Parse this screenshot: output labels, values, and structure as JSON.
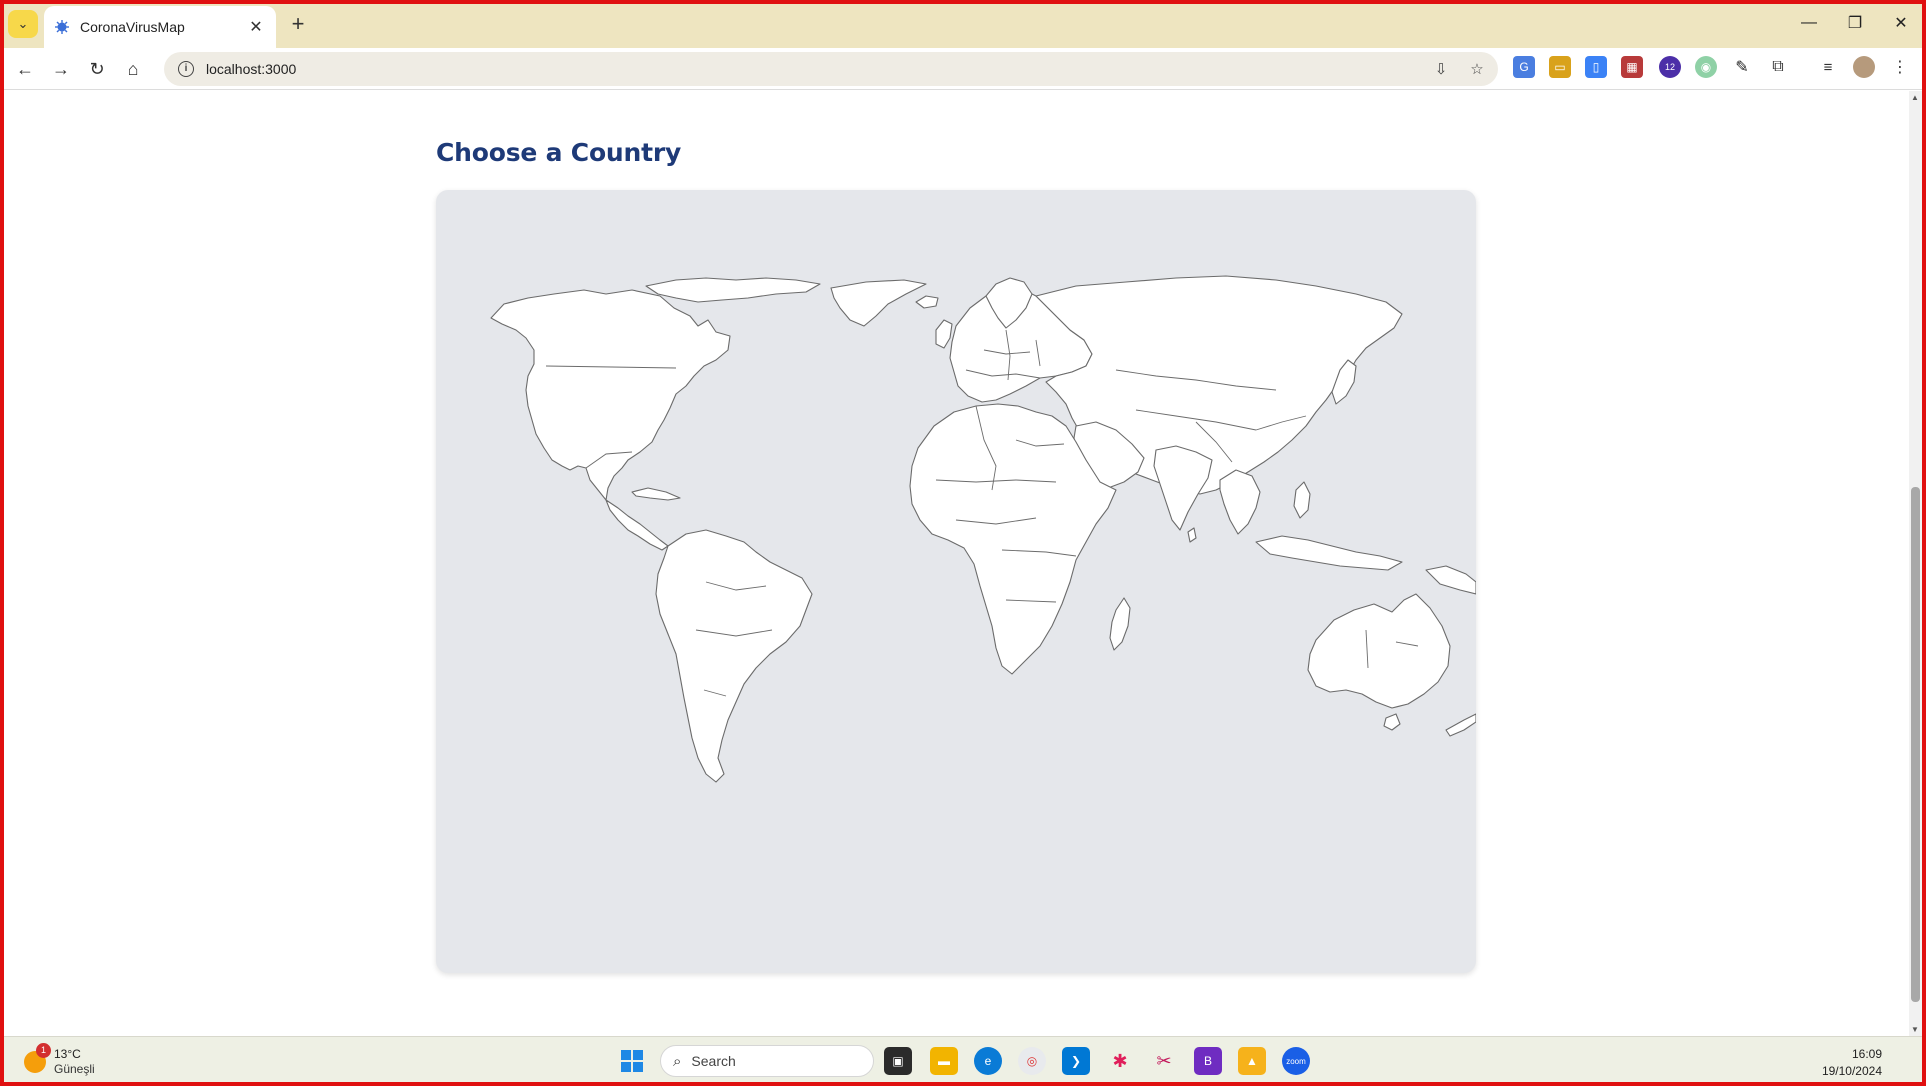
{
  "browser": {
    "tab_title": "CoronaVirusMap",
    "url": "localhost:3000",
    "tab_close": "✕",
    "new_tab": "+",
    "window_controls": {
      "minimize": "—",
      "maximize": "❐",
      "close": "✕"
    },
    "extensions_badge": "12"
  },
  "page": {
    "heading": "Choose a Country",
    "map_colors": {
      "land": "#ffffff",
      "ocean": "#e5e7eb",
      "border": "#6b6b6b"
    }
  },
  "taskbar": {
    "weather": {
      "temp": "13°C",
      "condition": "Güneşli",
      "badge": "1"
    },
    "search_label": "Search",
    "time": "16:09",
    "date": "19/10/2024"
  },
  "colors": {
    "heading": "#1e3a78",
    "tabstrip": "#eee5c0",
    "frame": "#e01010"
  }
}
